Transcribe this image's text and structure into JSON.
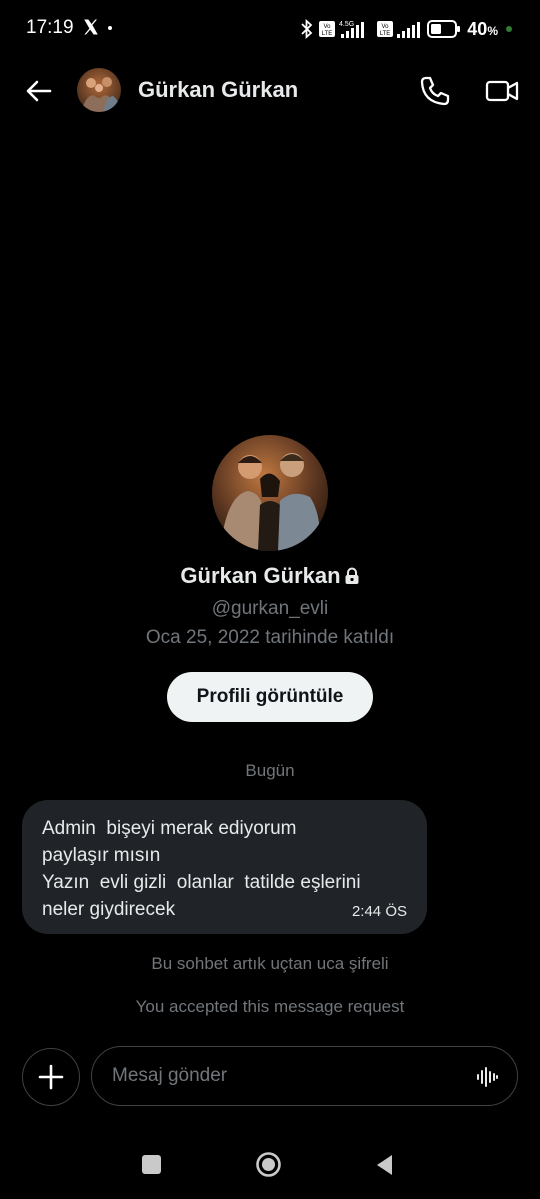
{
  "status_bar": {
    "time": "17:19",
    "battery_percent": "40",
    "battery_percent_unit": "%",
    "network_label": "4.5G",
    "volte_label": "Vo LTE"
  },
  "header": {
    "contact_name": "Gürkan Gürkan"
  },
  "profile": {
    "name": "Gürkan Gürkan",
    "handle": "@gurkan_evli",
    "joined": "Oca 25, 2022 tarihinde katıldı",
    "view_profile_label": "Profili görüntüle"
  },
  "conversation": {
    "date_separator": "Bugün",
    "messages": [
      {
        "lines": [
          "Admin  bişeyi merak ediyorum",
          "paylaşır mısın",
          "Yazın  evli gizli  olanlar  tatilde eşlerini",
          "neler giydirecek"
        ],
        "time": "2:44 ÖS"
      }
    ],
    "encryption_note": "Bu sohbet artık uçtan uca şifreli",
    "accepted_note": "You accepted this message request"
  },
  "composer": {
    "placeholder": "Mesaj gönder"
  },
  "icons": {
    "back": "arrow-left-icon",
    "call": "phone-icon",
    "video": "video-camera-icon",
    "lock": "lock-icon",
    "add": "plus-icon",
    "voice": "voice-wave-icon"
  },
  "colors": {
    "background": "#000000",
    "bubble": "#202327",
    "secondary_text": "#71767b",
    "primary_text": "#e7e9ea",
    "button_bg": "#eff3f4"
  }
}
